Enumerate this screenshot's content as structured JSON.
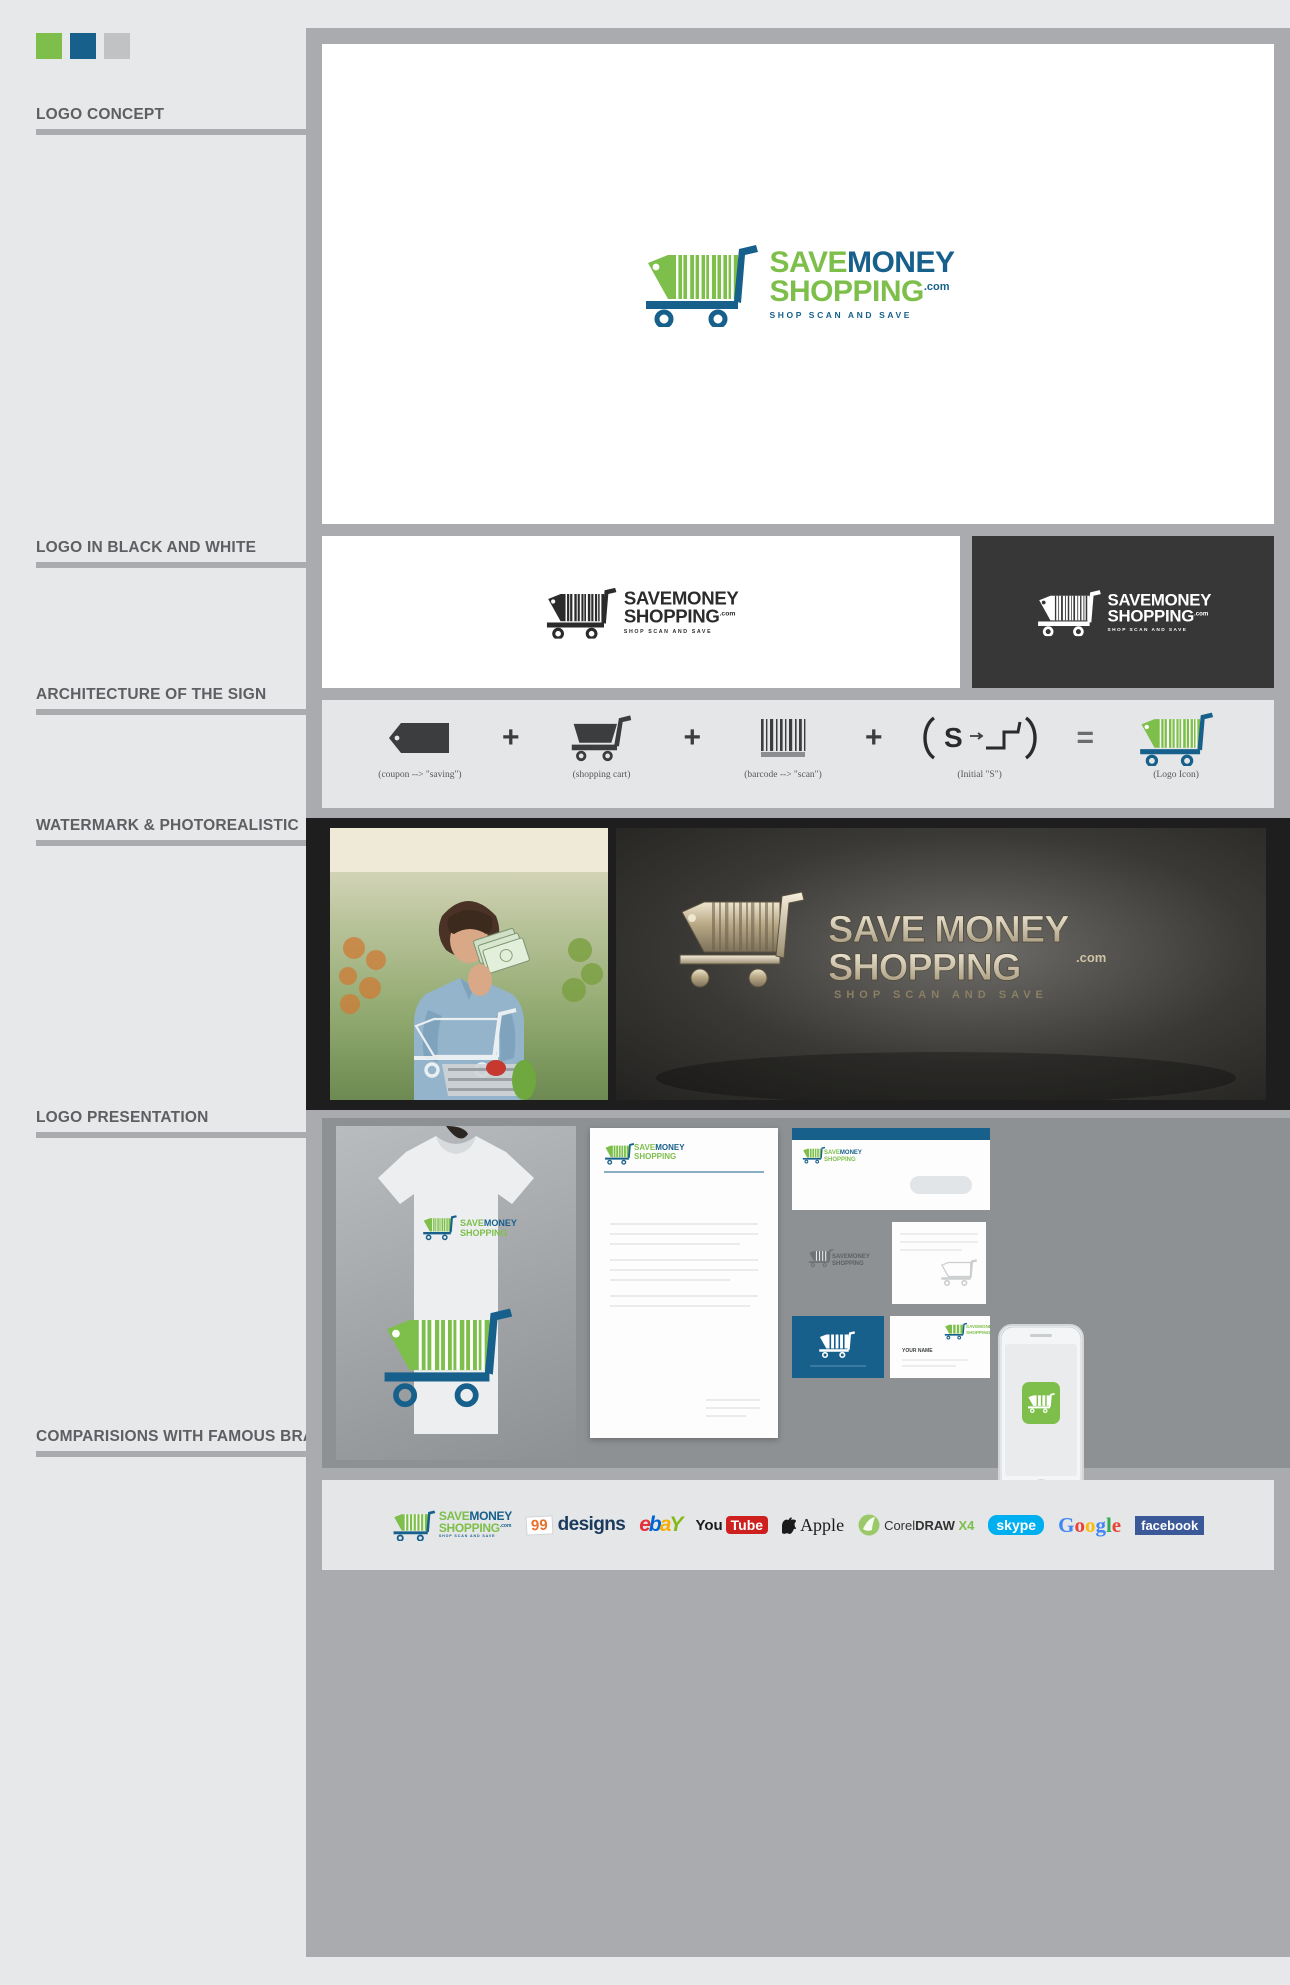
{
  "board": {
    "background_color": "#e6e8e9",
    "panel_color": "#a9abae"
  },
  "palette": {
    "green": "#7dbf4a",
    "blue": "#18608c",
    "grey": "#c0c2c4",
    "swatch_names": [
      "green-swatch",
      "blue-swatch",
      "grey-swatch"
    ]
  },
  "sections": [
    {
      "id": "logo-concept",
      "label": "LOGO CONCEPT"
    },
    {
      "id": "logo-bw",
      "label": "LOGO IN BLACK AND WHITE"
    },
    {
      "id": "architecture",
      "label": "ARCHITECTURE OF THE SIGN"
    },
    {
      "id": "watermark",
      "label": "WATERMARK & PHOTOREALISTIC"
    },
    {
      "id": "presentation",
      "label": "LOGO PRESENTATION"
    },
    {
      "id": "comparisons",
      "label": "COMPARISIONS WITH FAMOUS BRANDS"
    }
  ],
  "logo": {
    "line1_part1": "SAVE",
    "line1_part2": "MONEY",
    "line2": "SHOPPING",
    "line2_suffix": ".com",
    "tagline": "SHOP SCAN AND SAVE"
  },
  "architecture": {
    "items": [
      {
        "glyph": "coupon-tag-icon",
        "caption": "(coupon --> \"saving\")"
      },
      {
        "glyph": "shopping-cart-icon",
        "caption": "(shopping cart)"
      },
      {
        "glyph": "barcode-icon",
        "caption": "(barcode --> \"scan\")"
      },
      {
        "glyph": "initial-s-icon",
        "caption": "(Initial \"S\")"
      },
      {
        "glyph": "logo-icon",
        "caption": "(Logo Icon)"
      }
    ],
    "operator_plus": "+",
    "operator_equals": "="
  },
  "brands": {
    "items": [
      {
        "name": "save-money-shopping",
        "label": "SAVE MONEY SHOPPING"
      },
      {
        "name": "99designs",
        "label_99": "99",
        "label_designs": "designs"
      },
      {
        "name": "ebay",
        "label": "ebay"
      },
      {
        "name": "youtube",
        "label_you": "You",
        "label_tube": "Tube"
      },
      {
        "name": "apple",
        "label": "Apple"
      },
      {
        "name": "coreldraw",
        "label_corel": "Corel",
        "label_draw": "DRAW",
        "label_x4": "X4"
      },
      {
        "name": "skype",
        "label": "skype"
      },
      {
        "name": "google",
        "label": "Google"
      },
      {
        "name": "facebook",
        "label": "facebook"
      }
    ]
  }
}
